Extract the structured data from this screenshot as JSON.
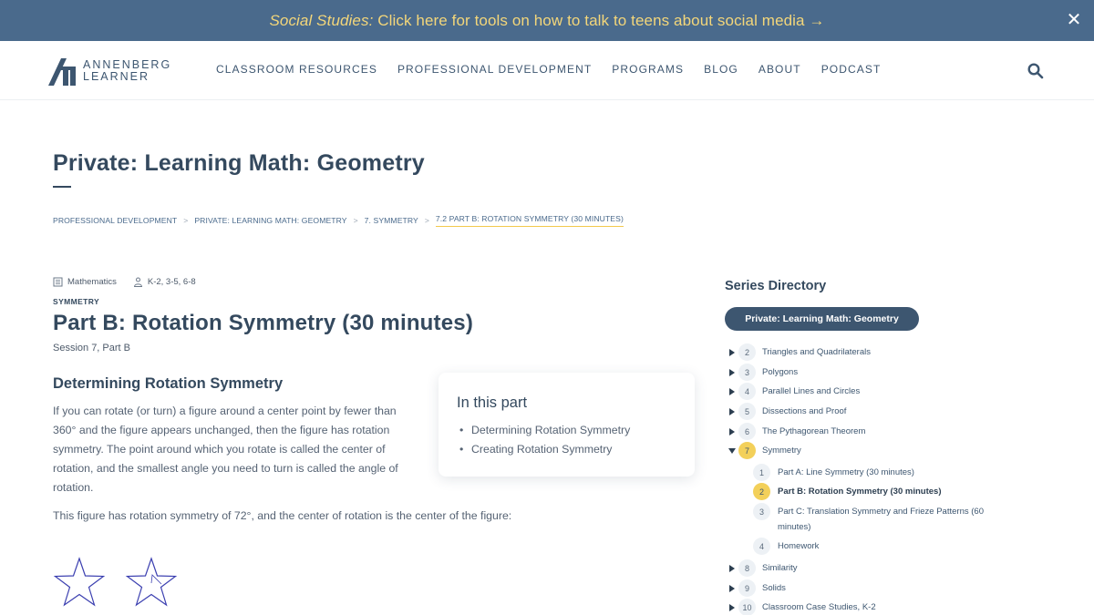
{
  "banner": {
    "prefix": "Social Studies:",
    "text": " Click here for tools on how to talk to teens about social media →",
    "close": "✕"
  },
  "logo": {
    "line1": "ANNENBERG",
    "line2": "LEARNER"
  },
  "nav": [
    "CLASSROOM RESOURCES",
    "PROFESSIONAL DEVELOPMENT",
    "PROGRAMS",
    "BLOG",
    "ABOUT",
    "PODCAST"
  ],
  "page": {
    "title": "Private: Learning Math: Geometry"
  },
  "breadcrumb": [
    "PROFESSIONAL DEVELOPMENT",
    "PRIVATE: LEARNING MATH: GEOMETRY",
    "7. SYMMETRY",
    "7.2 PART B: ROTATION SYMMETRY (30 MINUTES)"
  ],
  "breadcrumb_sep": ">",
  "meta": {
    "subject": "Mathematics",
    "grades": "K-2, 3-5, 6-8"
  },
  "content": {
    "eyebrow": "SYMMETRY",
    "title": "Part B: Rotation Symmetry (30 minutes)",
    "session": "Session 7, Part B",
    "heading": "Determining Rotation Symmetry",
    "paragraph1": "If you can rotate (or turn) a figure around a center point by fewer than 360° and the figure appears unchanged, then the figure has rotation symmetry. The point around which you rotate is called the center of rotation, and the smallest angle you need to turn is called the angle of rotation.",
    "paragraph2": "This figure has rotation symmetry of 72°, and the center of rotation is the center of the figure:"
  },
  "toc": {
    "title": "In this part",
    "items": [
      "Determining Rotation Symmetry",
      "Creating Rotation Symmetry"
    ]
  },
  "sidebar": {
    "title": "Series Directory",
    "series": "Private: Learning Math: Geometry",
    "sessions": [
      {
        "num": "2",
        "label": "Triangles and Quadrilaterals"
      },
      {
        "num": "3",
        "label": "Polygons"
      },
      {
        "num": "4",
        "label": "Parallel Lines and Circles"
      },
      {
        "num": "5",
        "label": "Dissections and Proof"
      },
      {
        "num": "6",
        "label": "The Pythagorean Theorem"
      },
      {
        "num": "7",
        "label": "Symmetry"
      },
      {
        "num": "8",
        "label": "Similarity"
      },
      {
        "num": "9",
        "label": "Solids"
      },
      {
        "num": "10",
        "label": "Classroom Case Studies, K-2"
      }
    ],
    "parts": [
      {
        "num": "1",
        "label": "Part A: Line Symmetry (30 minutes)"
      },
      {
        "num": "2",
        "label": "Part B: Rotation Symmetry (30 minutes)"
      },
      {
        "num": "3",
        "label": "Part C: Translation Symmetry and Frieze Patterns (60 minutes)"
      },
      {
        "num": "4",
        "label": "Homework"
      }
    ]
  },
  "colors": {
    "banner": "#4a6a8c",
    "banner_text": "#f3d67a",
    "navy": "#3d5670",
    "accent": "#f3d05a",
    "star": "#3b3fb0"
  }
}
